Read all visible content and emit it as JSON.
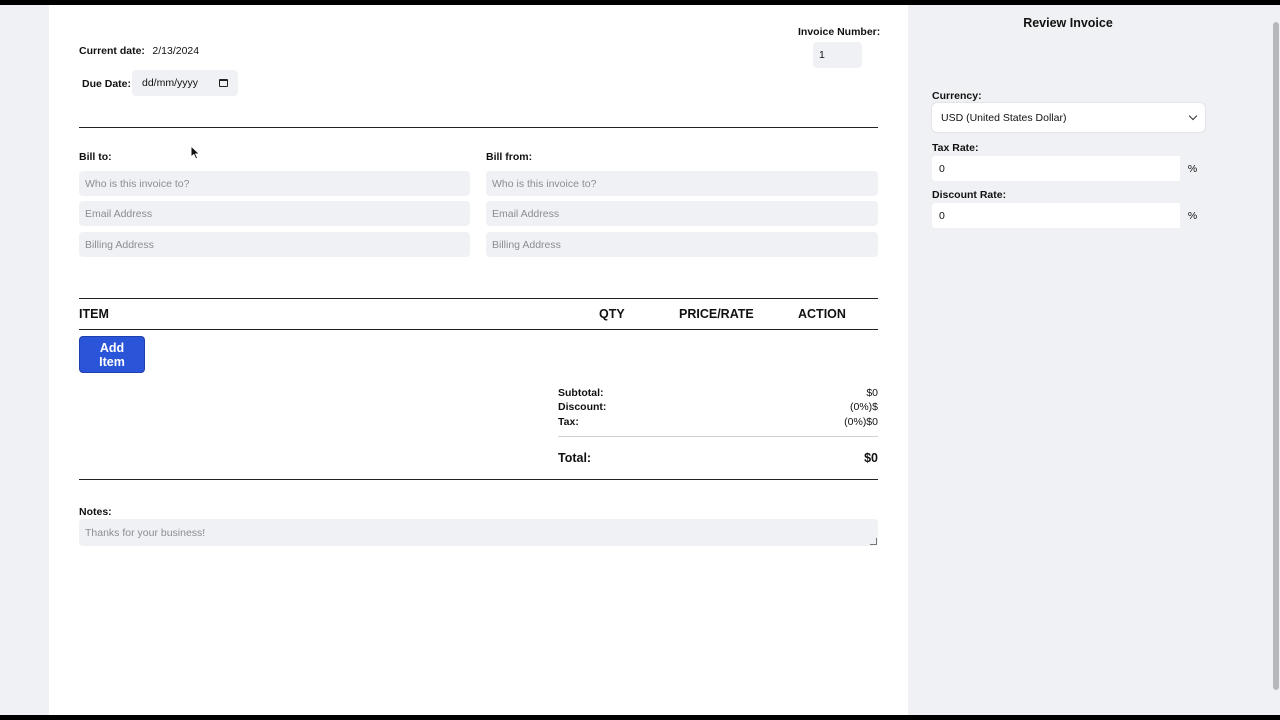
{
  "invoice": {
    "current_date_label": "Current date:",
    "current_date_value": "2/13/2024",
    "due_date_label": "Due Date:",
    "due_date_placeholder": "dd/mm/yyyy",
    "invoice_number_label": "Invoice Number:",
    "invoice_number_value": "1"
  },
  "bill_to": {
    "label": "Bill to:",
    "name_placeholder": "Who is this invoice to?",
    "email_placeholder": "Email Address",
    "address_placeholder": "Billing Address"
  },
  "bill_from": {
    "label": "Bill from:",
    "name_placeholder": "Who is this invoice to?",
    "email_placeholder": "Email Address",
    "address_placeholder": "Billing Address"
  },
  "items_table": {
    "columns": [
      "ITEM",
      "QTY",
      "PRICE/RATE",
      "ACTION"
    ],
    "add_item_label": "Add Item"
  },
  "totals": {
    "subtotal_label": "Subtotal:",
    "subtotal_value": "$0",
    "discount_label": "Discount:",
    "discount_value": "(0%)$",
    "tax_label": "Tax:",
    "tax_value": "(0%)$0",
    "total_label": "Total:",
    "total_value": "$0"
  },
  "notes": {
    "label": "Notes:",
    "placeholder": "Thanks for your business!"
  },
  "sidebar": {
    "review_button_label": "Review Invoice",
    "currency_label": "Currency:",
    "currency_selected": "USD (United States Dollar)",
    "tax_rate_label": "Tax Rate:",
    "tax_rate_value": "0",
    "discount_rate_label": "Discount Rate:",
    "discount_rate_value": "0",
    "percent_symbol": "%"
  },
  "icons": {
    "calendar": "calendar-icon",
    "chevron": "chevron-down-icon",
    "cursor": "mouse-pointer-icon",
    "resize": "resize-grip-icon"
  },
  "colors": {
    "accent": "#2a55d9",
    "field_bg": "#f0f1f4",
    "placeholder": "#8a8d93"
  }
}
